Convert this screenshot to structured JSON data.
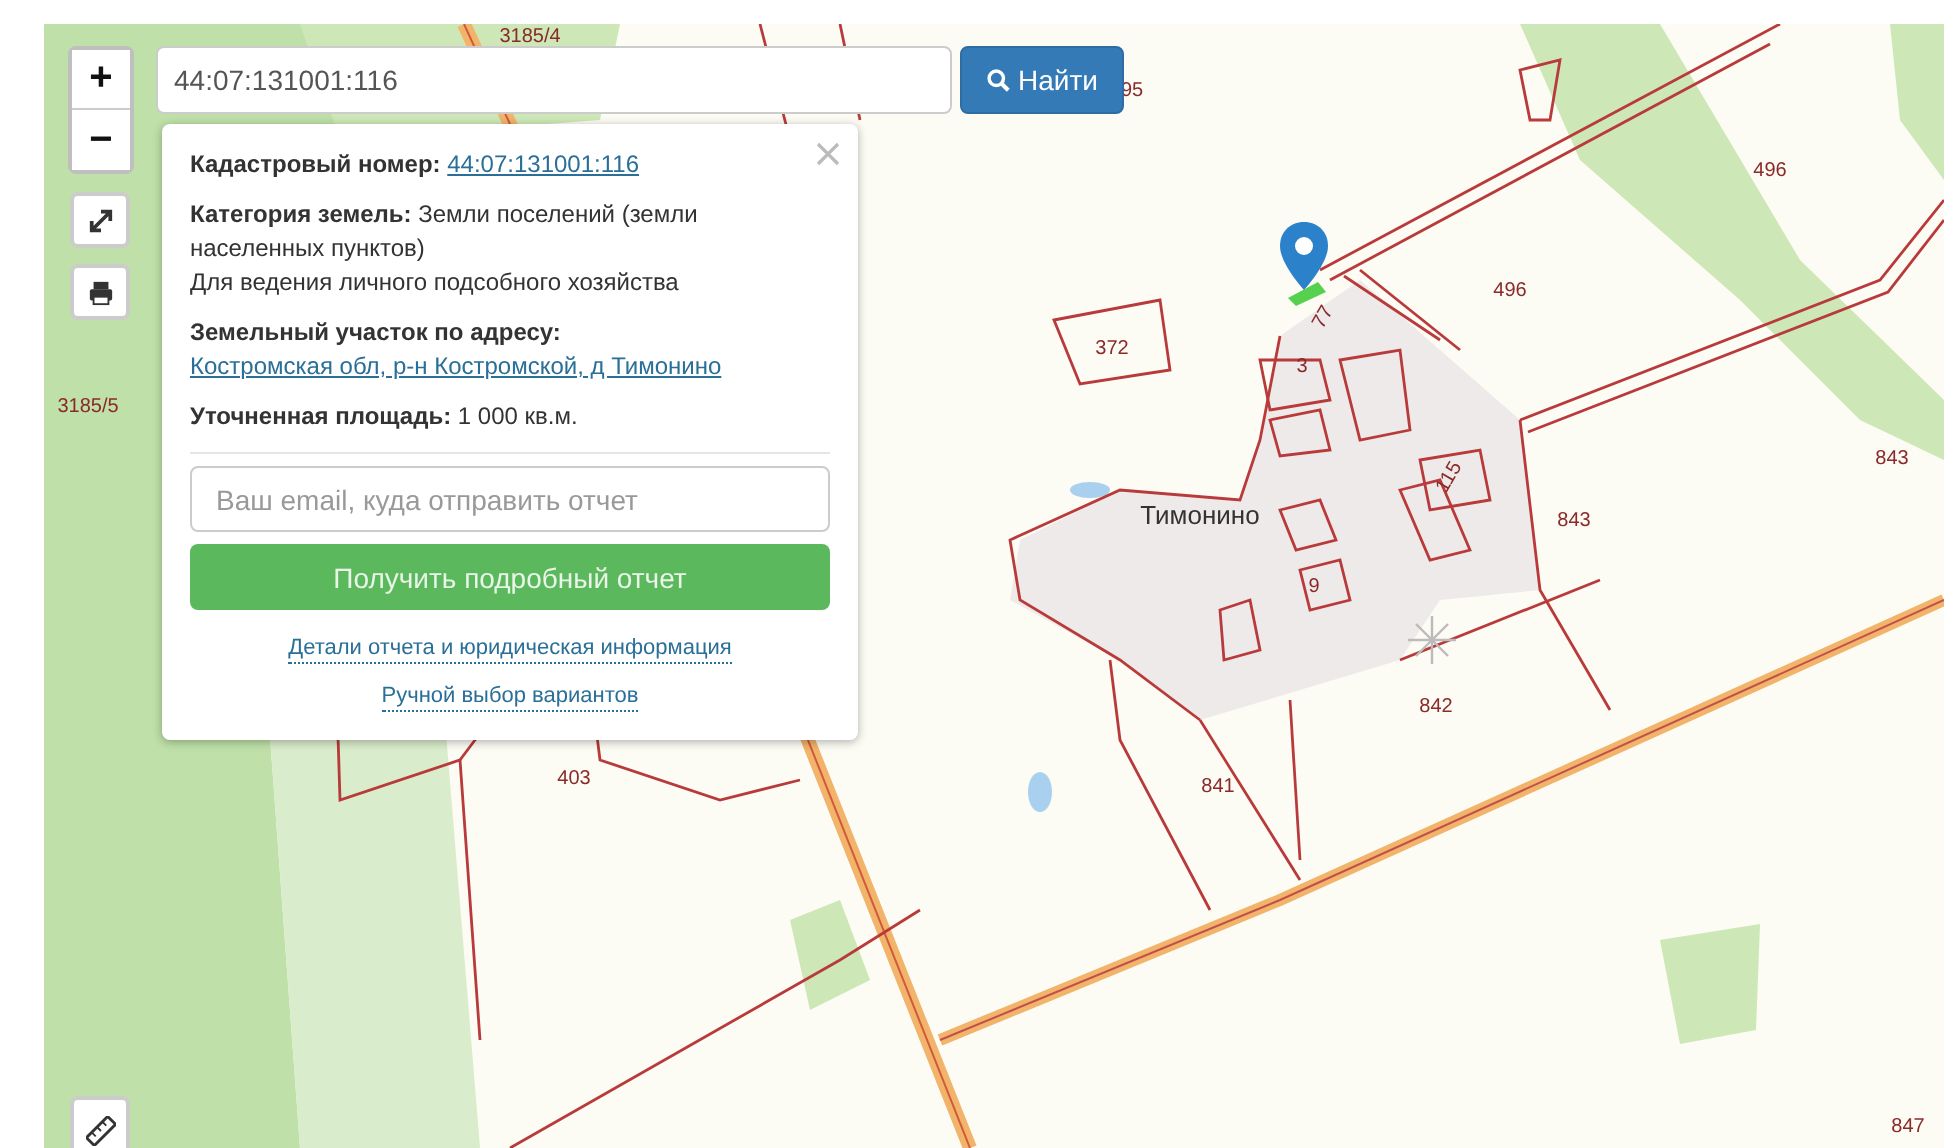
{
  "search": {
    "value": "44:07:131001:116",
    "button": "Найти"
  },
  "zoom_controls": [
    "+",
    "−"
  ],
  "popup": {
    "cadastral": {
      "label": "Кадастровый номер:",
      "value": "44:07:131001:116"
    },
    "category": {
      "label": "Категория земель:",
      "value": "Земли поселений (земли населенных пунктов)",
      "use": "Для ведения личного подсобного хозяйства"
    },
    "address": {
      "label": "Земельный участок по адресу:",
      "value": "Костромская обл, р-н Костромской, д Тимонино"
    },
    "area": {
      "label": "Уточненная площадь:",
      "value": "1 000 кв.м."
    },
    "email_placeholder": "Ваш email, куда отправить отчет",
    "submit": "Получить подробный отчет",
    "links": [
      "Детали отчета и юридическая информация",
      "Ручной выбор вариантов"
    ]
  },
  "map": {
    "labels": [
      {
        "text": "3185/4",
        "kind": "parcel"
      },
      {
        "text": "95",
        "kind": "parcel"
      },
      {
        "text": "496",
        "kind": "parcel"
      },
      {
        "text": "496",
        "kind": "parcel"
      },
      {
        "text": "372",
        "kind": "parcel"
      },
      {
        "text": "3",
        "kind": "parcel"
      },
      {
        "text": "77",
        "kind": "parcel"
      },
      {
        "text": "115",
        "kind": "parcel"
      },
      {
        "text": "9",
        "kind": "parcel"
      },
      {
        "text": "Тимонино",
        "kind": "settlement"
      },
      {
        "text": "843",
        "kind": "parcel"
      },
      {
        "text": "843",
        "kind": "parcel"
      },
      {
        "text": "842",
        "kind": "parcel"
      },
      {
        "text": "841",
        "kind": "parcel"
      },
      {
        "text": "403",
        "kind": "parcel"
      },
      {
        "text": "3185/5",
        "kind": "parcel"
      },
      {
        "text": "847",
        "kind": "parcel"
      }
    ]
  }
}
